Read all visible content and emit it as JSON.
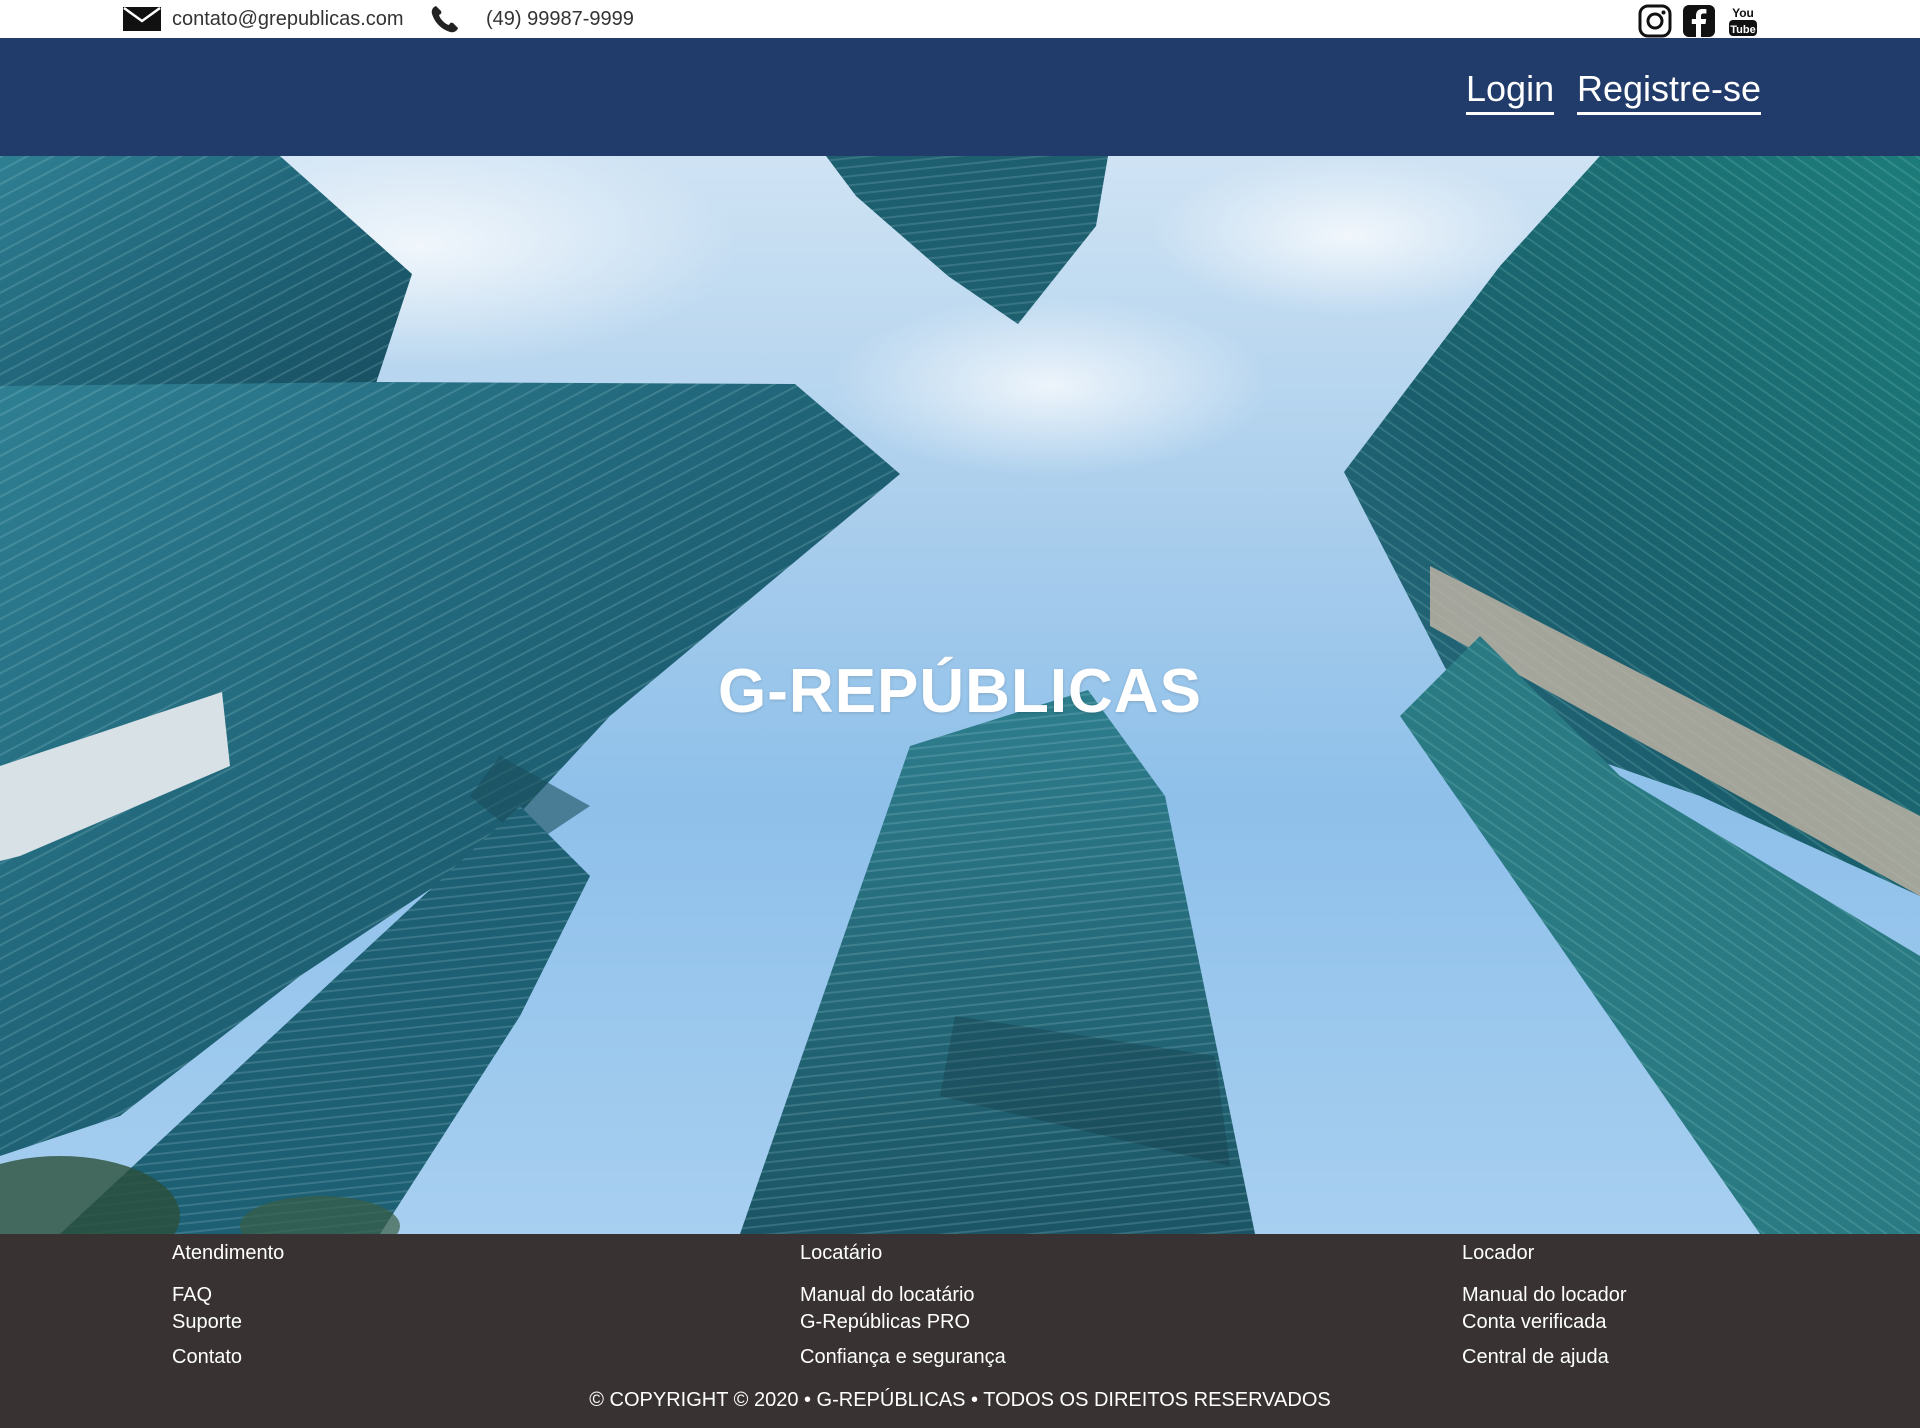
{
  "contact": {
    "email": "contato@grepublicas.com",
    "phone": "(49) 99987-9999",
    "email_icon": "envelope-icon",
    "phone_icon": "phone-icon"
  },
  "social": [
    "instagram-icon",
    "facebook-icon",
    "youtube-icon"
  ],
  "nav": {
    "login": "Login",
    "register": "Registre-se"
  },
  "hero": {
    "title": "G-REPÚBLICAS"
  },
  "footer": {
    "columns": [
      {
        "heading": "Atendimento",
        "links": [
          "FAQ",
          "Suporte",
          "Contato"
        ]
      },
      {
        "heading": "Locatário",
        "links": [
          "Manual do locatário",
          "G-Repúblicas PRO",
          "Confiança e segurança"
        ]
      },
      {
        "heading": "Locador",
        "links": [
          "Manual do locador",
          "Conta verificada",
          "Central de ajuda"
        ]
      }
    ],
    "copyright": "© COPYRIGHT © 2020 • G-REPÚBLICAS • TODOS OS DIREITOS RESERVADOS"
  },
  "colors": {
    "nav_bg": "#213c6b",
    "footer_bg": "#383332"
  }
}
